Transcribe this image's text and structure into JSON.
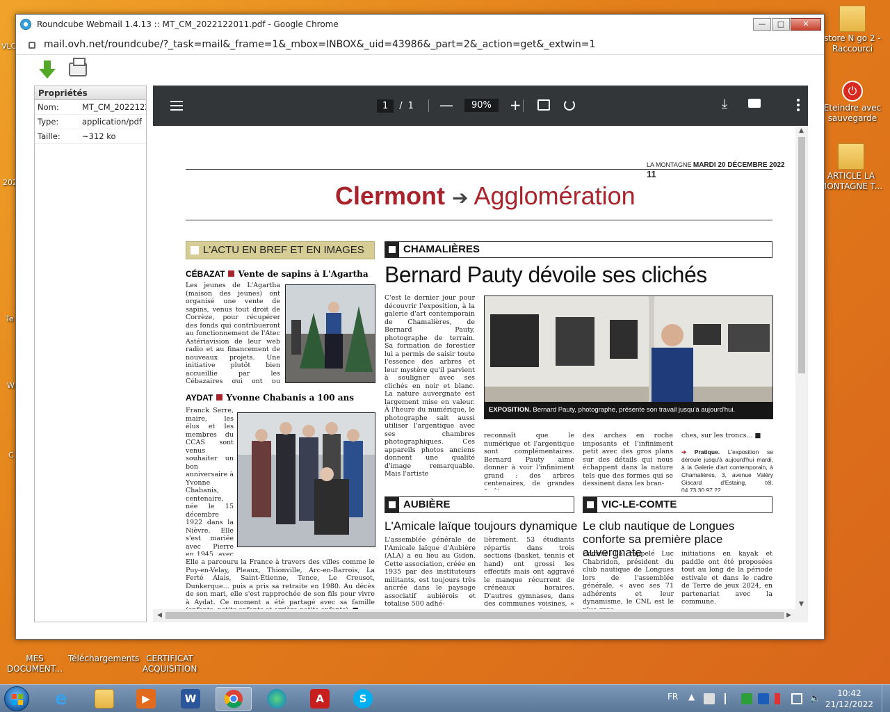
{
  "desktop": {
    "right_icons": [
      {
        "label": "store N go 2 - Raccourci"
      },
      {
        "label": "Eteindre avec sauvegarde"
      },
      {
        "label": "ARTICLE LA MONTAGNE T..."
      }
    ],
    "bottom_icons": [
      {
        "label": "MES DOCUMENT..."
      },
      {
        "label": "Téléchargements"
      },
      {
        "label": "CERTIFICAT ACQUISITION"
      }
    ],
    "left_edge_labels": [
      "VLC",
      "202",
      "Te",
      "W",
      "C"
    ]
  },
  "window": {
    "title": "Roundcube Webmail 1.4.13 :: MT_CM_2022122011.pdf - Google Chrome",
    "url": "mail.ovh.net/roundcube/?_task=mail&_frame=1&_mbox=INBOX&_uid=43986&_part=2&_action=get&_extwin=1",
    "controls": {
      "minimize": "—",
      "maximize": "□",
      "close": "✕"
    }
  },
  "properties": {
    "title": "Propriétés",
    "rows": [
      {
        "key": "Nom:",
        "value": "MT_CM_2022122011.pdf"
      },
      {
        "key": "Type:",
        "value": "application/pdf"
      },
      {
        "key": "Taille:",
        "value": "~312 ko"
      }
    ]
  },
  "pdf_viewer": {
    "page_current": "1",
    "page_sep": "/",
    "page_total": "1",
    "zoom": "90%",
    "zoom_minus": "—",
    "zoom_plus": "+"
  },
  "newspaper": {
    "publication": "LA MONTAGNE",
    "date": "MARDI 20 DÉCEMBRE 2022",
    "page_number": "11",
    "masthead_city": "Clermont",
    "masthead_section": "Agglomération",
    "briefs_header": "L'ACTU EN BREF ET EN IMAGES",
    "brief1": {
      "place": "CÉBAZAT",
      "title": "Vente de sapins à L'Agartha",
      "text": "Les jeunes de L'Agartha (maison des jeunes) ont organisé une vente de sapins, venus tout droit de Corrèze, pour récupérer des fonds qui contribueront au fonctionnement de l'Atec Astériavision de leur web radio et au financement de nouveaux projets. Une initiative plutôt bien accueillie par les Cébazaires qui ont pu s'approvisionner à deux pas de chez eux. ■"
    },
    "brief2": {
      "place": "AYDAT",
      "title": "Yvonne Chabanis a 100 ans",
      "text": "Franck Serre, maire, les élus et les membres du CCAS sont venus souhaiter un bon anniversaire à Yvonne Chabanis, centenaire, née le 15 décembre 1922 dans la Nièvre. Elle s'est mariée avec Pierre en 1945, avec qui elle aura trois enfants Yves, Pierrette et Martine.",
      "text2": "Elle a parcouru la France à travers des villes comme le Puy-en-Velay, Pleaux, Thionville, Arc-en-Barrois, La Ferté Alais, Saint-Étienne, Tence, Le Creusot, Dunkerque... puis a pris sa retraite en 1980. Au décès de son mari, elle s'est rapprochée de son fils pour vivre à Aydat. Ce moment a été partagé avec sa famille (enfants, petits-enfants et arrière-petits-enfants). ■"
    },
    "main": {
      "section": "CHAMALIÈRES",
      "title": "Bernard Pauty dévoile ses clichés",
      "col1": "C'est le dernier jour pour découvrir l'exposition, à la galerie d'art contemporain de Chamalières, de Bernard Pauty, photographe de terrain. Sa formation de forestier lui a permis de saisir toute l'essence des arbres et leur mystère qu'il parvient à souligner avec ses clichés en noir et blanc. La nature auvergnate est largement mise en valeur. À l'heure du numérique, le photographe sait aussi utiliser l'argentique avec ses chambres photographiques. Ces appareils photos anciens donnent une qualité d'image remarquable. Mais l'artiste",
      "col2": "reconnaît que le numérique et l'argentique sont complémentaires. Bernard Pauty aime donner à voir l'infiniment grand : des arbres centenaires, de grandes forêts,",
      "col3": "des arches en roche imposants et l'infiniment petit avec des gros plans sur des détails qui nous échappent dans la nature tels que des formes qui se dessinent dans les bran-",
      "col4": "ches, sur les troncs... ■",
      "pratique_label": "Pratique.",
      "pratique_text": "L'exposition se déroule jusqu'à aujourd'hui mardi, à la Galerie d'art contemporain, à Chamalières, 3, avenue Valéry Giscard d'Estaing, tél. 04.73.30.97.22.",
      "caption_label": "EXPOSITION.",
      "caption_text": "Bernard Pauty, photographe, présente son travail jusqu'à aujourd'hui."
    },
    "aubiere": {
      "section": "AUBIÈRE",
      "title": "L'Amicale laïque toujours dynamique",
      "col1": "L'assemblée générale de l'Amicale laïque d'Aubière (ALA) a eu lieu au Gidon. Cette association, créée en 1935 par des instituteurs militants, est toujours très ancrée dans le paysage associatif aubiérois et totalise 500 adhé-",
      "col2": "lièrement. 53 étudiants répartis dans trois sections (basket, tennis et hand) ont grossi les effectifs mais ont aggravé le manque récurrent de créneaux horaires. D'autres gymnases, dans des communes voisines, « pourraient peut-être"
    },
    "vic": {
      "section": "VIC-LE-COMTE",
      "title": "Le club nautique de Longues conforte sa première place auvergnate",
      "col1": "Comme l'a rappelé Luc Chabridon, président du club nautique de Longues lors de l'assemblée générale, « avec ses 71 adhérents et leur dynamisme, le CNL est le plus gros",
      "col2": "initiations en kayak et paddle ont été proposées tout au long de la période estivale et dans le cadre de Terre de jeux 2024, en partenariat avec la commune."
    }
  },
  "taskbar": {
    "lang": "FR",
    "time": "10:42",
    "date": "21/12/2022"
  },
  "colors": {
    "accent": "#a8232b",
    "pdf_bar": "#323639",
    "taskbar": "#6a87a8"
  }
}
